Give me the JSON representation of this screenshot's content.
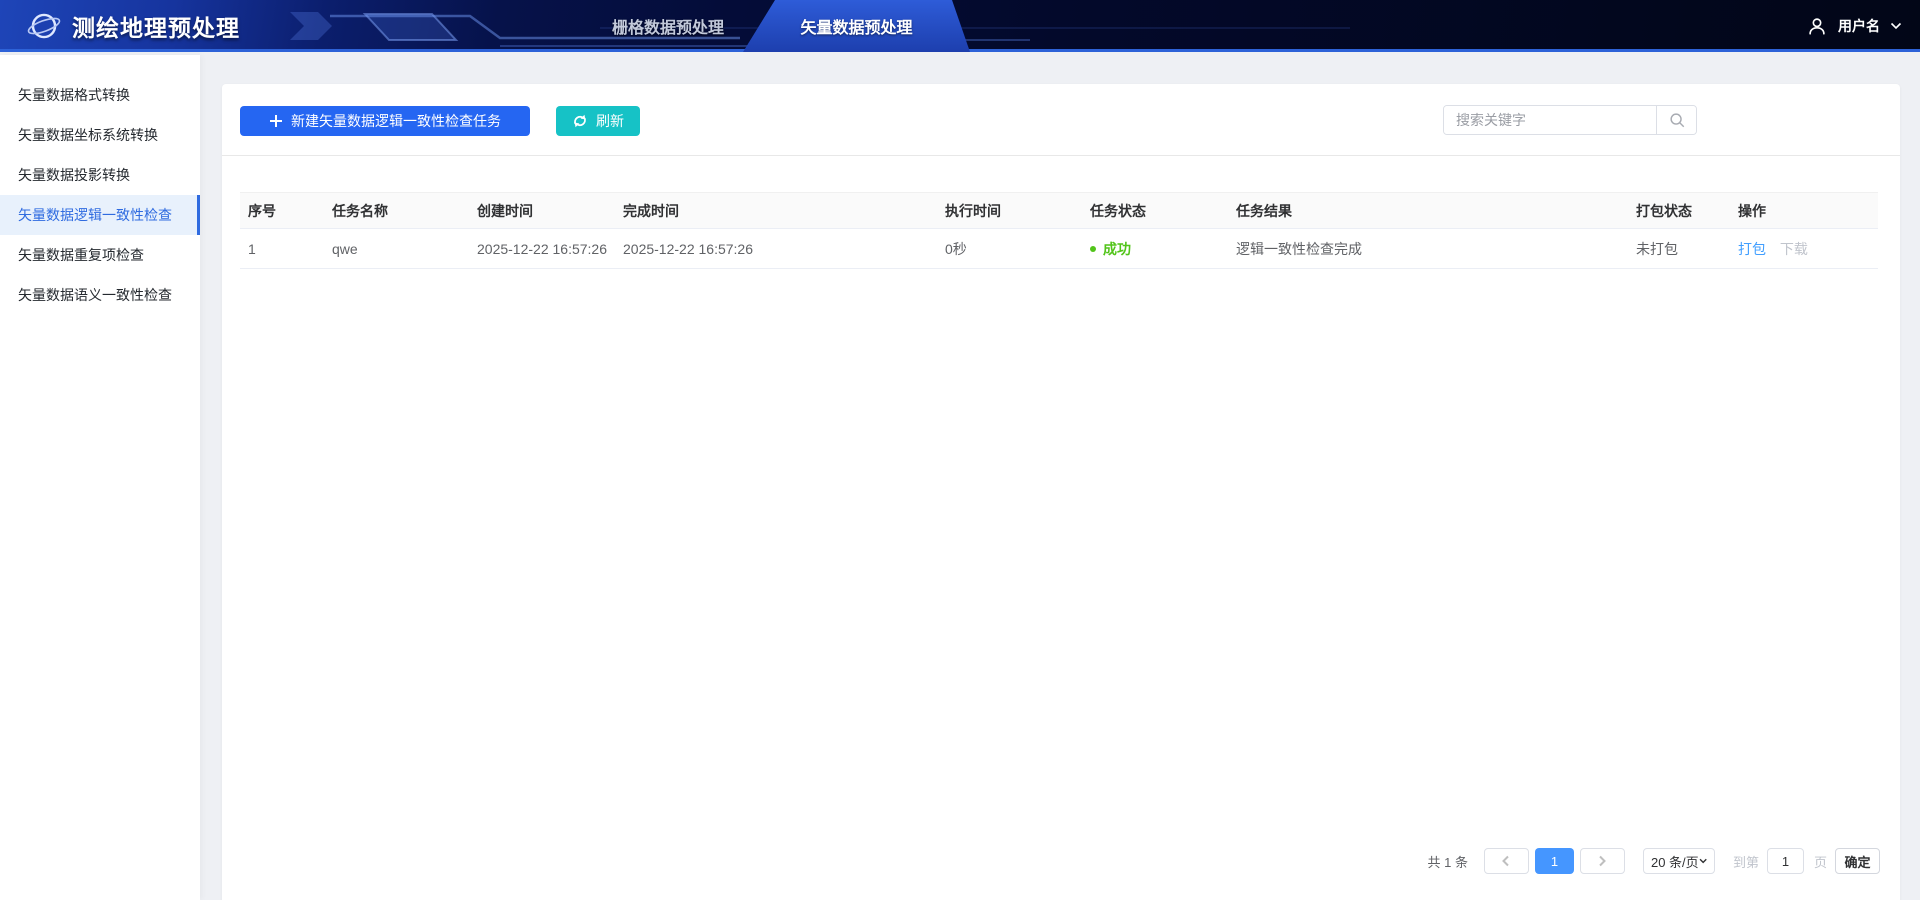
{
  "app": {
    "title": "测绘地理预处理"
  },
  "nav": {
    "tabs": [
      {
        "label": "栅格数据预处理",
        "active": false
      },
      {
        "label": "矢量数据预处理",
        "active": true
      }
    ],
    "user": {
      "name": "用户名"
    }
  },
  "sidebar": {
    "items": [
      {
        "label": "矢量数据格式转换",
        "active": false
      },
      {
        "label": "矢量数据坐标系统转换",
        "active": false
      },
      {
        "label": "矢量数据投影转换",
        "active": false
      },
      {
        "label": "矢量数据逻辑一致性检查",
        "active": true
      },
      {
        "label": "矢量数据重复项检查",
        "active": false
      },
      {
        "label": "矢量数据语义一致性检查",
        "active": false
      }
    ]
  },
  "toolbar": {
    "new_task_label": "新建矢量数据逻辑一致性检查任务",
    "refresh_label": "刷新",
    "search_placeholder": "搜索关键字"
  },
  "table": {
    "columns": [
      "序号",
      "任务名称",
      "创建时间",
      "完成时间",
      "执行时间",
      "任务状态",
      "任务结果",
      "打包状态",
      "操作"
    ],
    "rows": [
      {
        "index": "1",
        "name": "qwe",
        "created": "2025-12-22 16:57:26",
        "finished": "2025-12-22 16:57:26",
        "duration": "0秒",
        "status": "成功",
        "result": "逻辑一致性检查完成",
        "package_status": "未打包",
        "action_package": "打包",
        "action_download": "下载"
      }
    ]
  },
  "pagination": {
    "total": "共 1 条",
    "current_page": "1",
    "page_size": "20 条/页",
    "goto_prefix": "到第",
    "goto_value": "1",
    "goto_suffix": "页",
    "confirm": "确定"
  },
  "colors": {
    "brand_blue": "#2566f2",
    "teal": "#16c2c6",
    "nav_dark": "#03092b",
    "nav_border": "#2d62d8",
    "active_tab_blue": "#1d3fae",
    "sidebar_active_text": "#2f6be0",
    "success_green": "#52c41a",
    "link_blue": "#409eff",
    "active_page_blue": "#4596ff"
  }
}
